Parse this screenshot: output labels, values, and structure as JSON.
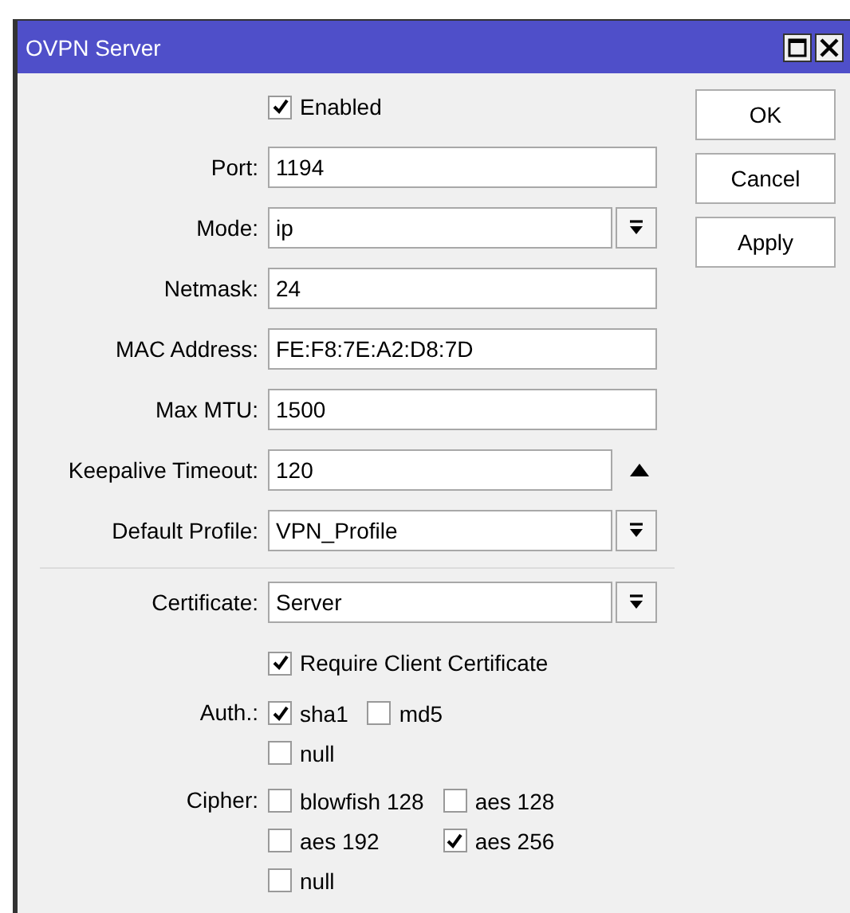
{
  "window": {
    "title": "OVPN Server"
  },
  "enabled": {
    "label": "Enabled",
    "checked": true
  },
  "fields": [
    {
      "label": "Port:",
      "value": "1194",
      "kind": "text"
    },
    {
      "label": "Mode:",
      "value": "ip",
      "kind": "select"
    },
    {
      "label": "Netmask:",
      "value": "24",
      "kind": "text"
    },
    {
      "label": "MAC Address:",
      "value": "FE:F8:7E:A2:D8:7D",
      "kind": "text"
    },
    {
      "label": "Max MTU:",
      "value": "1500",
      "kind": "text"
    },
    {
      "label": "Keepalive Timeout:",
      "value": "120",
      "kind": "spin"
    },
    {
      "label": "Default Profile:",
      "value": "VPN_Profile",
      "kind": "select"
    }
  ],
  "certificate": {
    "label": "Certificate:",
    "value": "Server",
    "kind": "select"
  },
  "require_client_certificate": {
    "label": "Require Client Certificate",
    "checked": true
  },
  "auth": {
    "label": "Auth.:",
    "options": [
      {
        "label": "sha1",
        "checked": true
      },
      {
        "label": "md5",
        "checked": false
      },
      {
        "label": "null",
        "checked": false
      }
    ]
  },
  "cipher": {
    "label": "Cipher:",
    "options": [
      {
        "label": "blowfish 128",
        "checked": false
      },
      {
        "label": "aes 128",
        "checked": false
      },
      {
        "label": "aes 192",
        "checked": false
      },
      {
        "label": "aes 256",
        "checked": true
      },
      {
        "label": "null",
        "checked": false
      }
    ]
  },
  "buttons": [
    "OK",
    "Cancel",
    "Apply"
  ]
}
